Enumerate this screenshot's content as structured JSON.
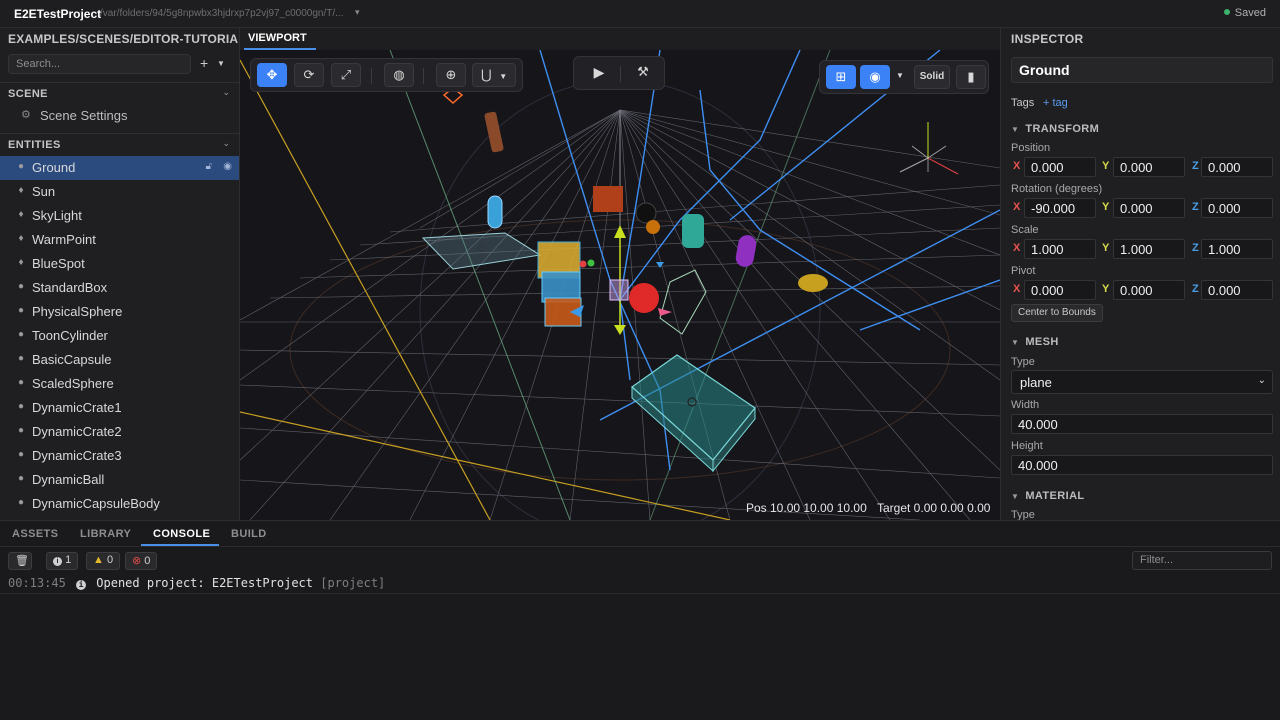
{
  "app": {
    "project_name": "E2ETestProject",
    "project_path": "/var/folders/94/5g8npwbx3hjdrxp7p2vj97_c0000gn/T/...",
    "save_status": "Saved"
  },
  "left_panel": {
    "scene_path": "EXAMPLES/SCENES/EDITOR-TUTORIAL.VS",
    "search_placeholder": "Search...",
    "add_label": "+",
    "scene_section": "SCENE",
    "scene_settings": "Scene Settings",
    "entities_section": "ENTITIES",
    "entities": [
      {
        "name": "Ground",
        "icon": "mesh-icon",
        "selected": true
      },
      {
        "name": "Sun",
        "icon": "light-icon"
      },
      {
        "name": "SkyLight",
        "icon": "light-icon"
      },
      {
        "name": "WarmPoint",
        "icon": "light-icon"
      },
      {
        "name": "BlueSpot",
        "icon": "light-icon"
      },
      {
        "name": "StandardBox",
        "icon": "mesh-icon"
      },
      {
        "name": "PhysicalSphere",
        "icon": "mesh-icon"
      },
      {
        "name": "ToonCylinder",
        "icon": "mesh-icon"
      },
      {
        "name": "BasicCapsule",
        "icon": "mesh-icon"
      },
      {
        "name": "ScaledSphere",
        "icon": "mesh-icon"
      },
      {
        "name": "DynamicCrate1",
        "icon": "mesh-icon"
      },
      {
        "name": "DynamicCrate2",
        "icon": "mesh-icon"
      },
      {
        "name": "DynamicCrate3",
        "icon": "mesh-icon"
      },
      {
        "name": "DynamicBall",
        "icon": "mesh-icon"
      },
      {
        "name": "DynamicCapsuleBody",
        "icon": "mesh-icon"
      }
    ]
  },
  "viewport": {
    "tab_label": "VIEWPORT",
    "render_mode": "Solid",
    "camera_pos": "Pos 10.00 10.00 10.00",
    "camera_target": "Target 0.00 0.00 0.00",
    "accent_color": "#3b82f6"
  },
  "inspector": {
    "title": "INSPECTOR",
    "entity_name": "Ground",
    "tags_label": "Tags",
    "add_tag": "+ tag",
    "transform": {
      "section": "TRANSFORM",
      "position_label": "Position",
      "position": {
        "x": "0.000",
        "y": "0.000",
        "z": "0.000"
      },
      "rotation_label": "Rotation (degrees)",
      "rotation": {
        "x": "-90.000",
        "y": "0.000",
        "z": "0.000"
      },
      "scale_label": "Scale",
      "scale": {
        "x": "1.000",
        "y": "1.000",
        "z": "1.000"
      },
      "pivot_label": "Pivot",
      "pivot": {
        "x": "0.000",
        "y": "0.000",
        "z": "0.000"
      },
      "center_button": "Center to Bounds",
      "axis_labels": {
        "x": "X",
        "y": "Y",
        "z": "Z"
      }
    },
    "mesh": {
      "section": "MESH",
      "type_label": "Type",
      "type_value": "plane",
      "width_label": "Width",
      "width": "40.000",
      "height_label": "Height",
      "height": "40.000"
    },
    "material": {
      "section": "MATERIAL",
      "type_label": "Type"
    }
  },
  "bottom_panel": {
    "tabs": [
      "ASSETS",
      "LIBRARY",
      "CONSOLE",
      "BUILD"
    ],
    "active_tab": "CONSOLE",
    "counts": {
      "info": "1",
      "warnings": "0",
      "errors": "0"
    },
    "filter_placeholder": "Filter...",
    "log": {
      "time": "00:13:45",
      "message": "Opened project: E2ETestProject",
      "tag": "[project]"
    }
  }
}
